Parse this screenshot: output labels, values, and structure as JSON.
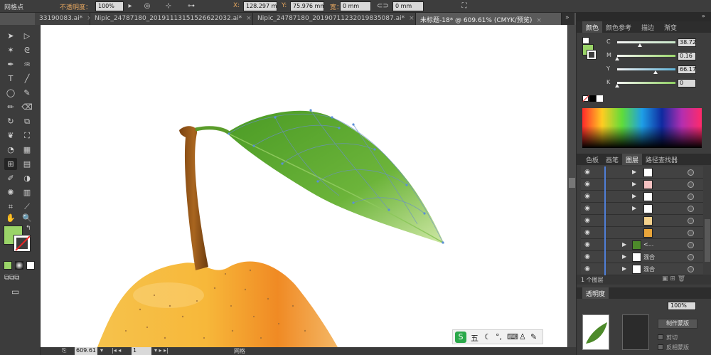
{
  "control_bar": {
    "selection_type": "网格点",
    "opacity_label": "不透明度：",
    "opacity_value": "100%",
    "x_label": "X:",
    "x_value": "128.297 m",
    "y_label": "Y:",
    "y_value": "75.976 mm",
    "w_label": "宽：",
    "w_value": "0 mm",
    "h_value": "0 mm"
  },
  "tabs": [
    {
      "label": "33190083.ai*",
      "active": false
    },
    {
      "label": "Nipic_24787180_20191113151526622032.ai*",
      "active": false
    },
    {
      "label": "Nipic_24787180_20190711232019835087.ai*",
      "active": false
    },
    {
      "label": "未标题-18* @ 609.61% (CMYK/预览)",
      "active": true
    }
  ],
  "color_panel": {
    "tabs": [
      "颜色",
      "颜色参考",
      "描边",
      "渐变"
    ],
    "sliders": [
      {
        "label": "C",
        "value": "38.72",
        "pos": 0.387,
        "track": "#c8e6c8"
      },
      {
        "label": "M",
        "value": "0.16",
        "pos": 0.0016,
        "track": "#9cd86c"
      },
      {
        "label": "Y",
        "value": "66.17",
        "pos": 0.66,
        "track": "#5fb3d8"
      },
      {
        "label": "K",
        "value": "0",
        "pos": 0,
        "track": "#8fcf62"
      }
    ],
    "fill_color": "#9ad468"
  },
  "layers_panel": {
    "tabs": [
      "色板",
      "画笔",
      "图层",
      "路径查找器"
    ],
    "rows": [
      {
        "name": "",
        "thumb": "#ffffff"
      },
      {
        "name": "",
        "thumb": "#f5c2c2"
      },
      {
        "name": "",
        "thumb": "#ffffff"
      },
      {
        "name": "",
        "thumb": "#ffffff"
      },
      {
        "name": "",
        "thumb": "#f3d18c"
      },
      {
        "name": "",
        "thumb": "#e9a53a"
      },
      {
        "name": "<...",
        "thumb": "#4d8a2a"
      },
      {
        "name": "混合",
        "thumb": "#ffffff"
      },
      {
        "name": "混合",
        "thumb": "#ffffff"
      }
    ],
    "footer_count": "1 个图层"
  },
  "transparency_panel": {
    "tab": "透明度",
    "opacity_value": "100%",
    "make_mask": "制作蒙版",
    "clip": "剪切",
    "invert_mask": "反相蒙版"
  },
  "status": {
    "zoom": "609.61",
    "page": "1",
    "tool": "网格"
  },
  "ime": {
    "label": "五"
  }
}
